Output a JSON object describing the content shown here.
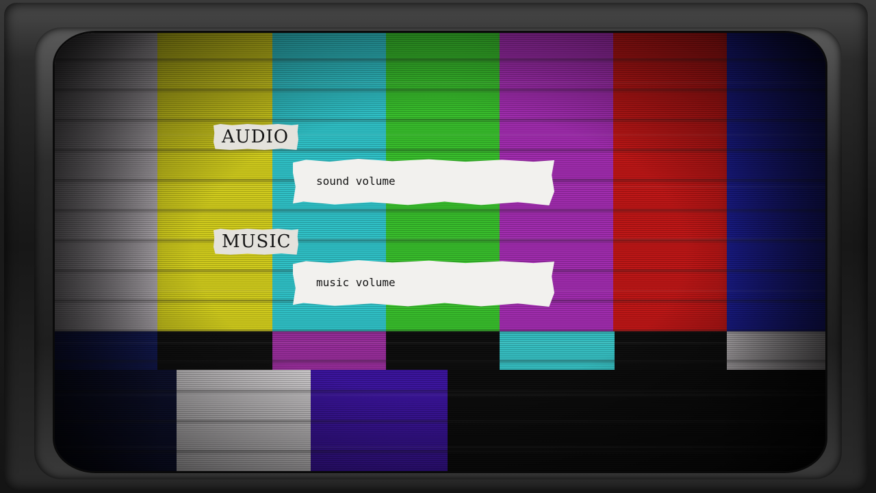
{
  "menu": {
    "audio_section": {
      "label": "AUDIO",
      "slider_label": "sound volume"
    },
    "music_section": {
      "label": "MUSIC",
      "slider_label": "music volume"
    }
  },
  "background": {
    "type": "tv-color-bars",
    "top_bar_colors": [
      "#b9b3b9",
      "#d9d41b",
      "#2fc9cf",
      "#38c52b",
      "#a62bb5",
      "#c51414",
      "#1a1c9a"
    ],
    "middle_bar_colors": [
      "#121a5a",
      "#0d0d0d",
      "#9b2c9e",
      "#0b0b0b",
      "#36c6c9",
      "#0b0b0b",
      "#c6c1c4"
    ],
    "bottom_bar_colors": [
      "#0e1235",
      "#d3d0d2",
      "#3b12a2",
      "#0a0a0a"
    ]
  }
}
